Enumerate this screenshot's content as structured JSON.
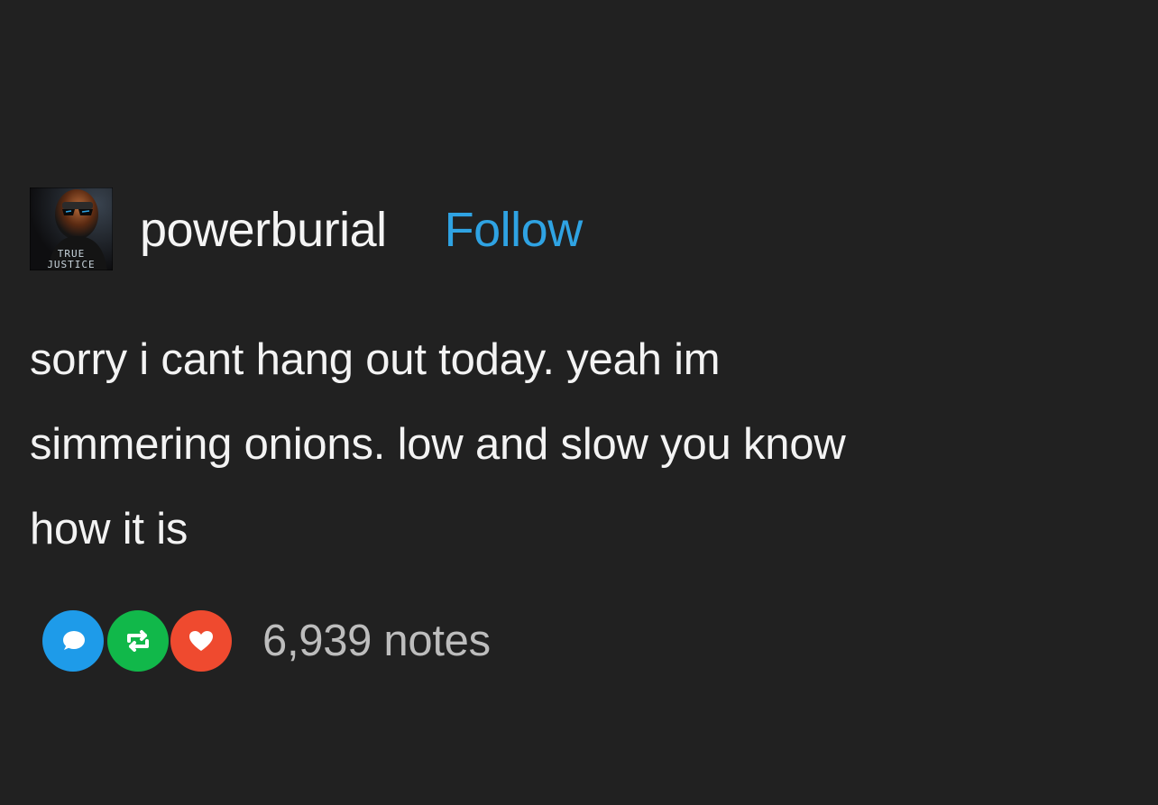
{
  "post": {
    "blog_name": "powerburial",
    "follow_label": "Follow",
    "avatar_caption": "TRUE\nJUSTICE",
    "body_lines": [
      "sorry i cant hang out today. yeah im",
      "simmering onions. low and slow you know",
      "how it is"
    ]
  },
  "footer": {
    "icons": [
      "reply-icon",
      "reblog-icon",
      "like-icon"
    ],
    "notes_label": "6,939 notes"
  },
  "colors": {
    "background": "#212121",
    "follow": "#2fa3e3",
    "reply": "#1e9be9",
    "reblog": "#11b84a",
    "like": "#ef4a2f"
  }
}
